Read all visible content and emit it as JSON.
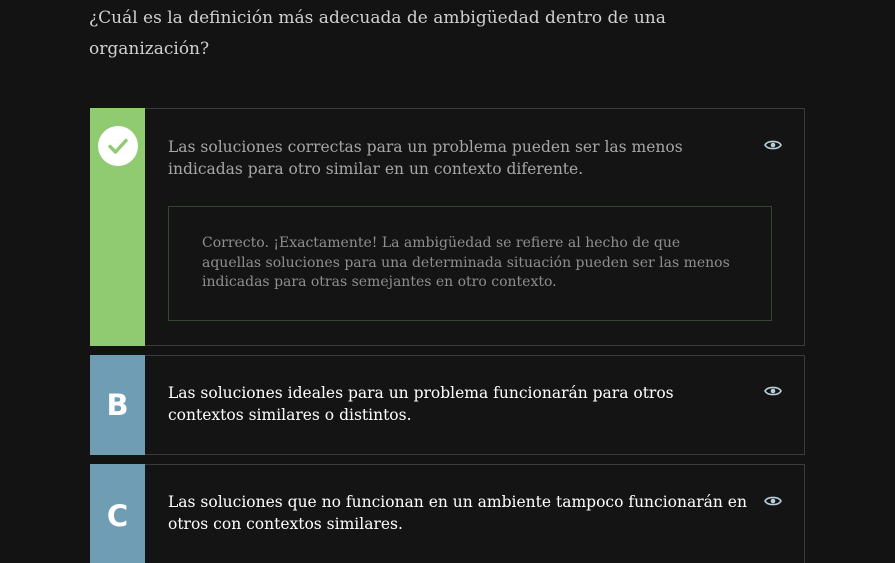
{
  "question": {
    "text": "¿Cuál es la definición más adecuada de ambigüedad dentro de una organización?"
  },
  "options": [
    {
      "status": "correct",
      "marker_icon": "check-icon",
      "text": "Las soluciones correctas para un problema pueden ser las menos indicadas para otro similar en un contexto diferente.",
      "feedback": "Correcto. ¡Exactamente! La ambigüedad se refiere al hecho de que aquellas soluciones para una determinada situación pueden ser las menos indicadas para otras semejantes en otro contexto."
    },
    {
      "letter": "B",
      "text": "Las soluciones ideales para un problema funcionarán para otros contextos similares o distintos."
    },
    {
      "letter": "C",
      "text": "Las soluciones que no funcionan en un ambiente tampoco funcionarán en otros con contextos similares."
    }
  ],
  "icons": {
    "reveal": "eye-icon"
  },
  "colors": {
    "background": "#131313",
    "correct_marker": "#91cb71",
    "option_marker": "#6f9db3",
    "feedback_border": "#334630",
    "card_border": "#3b3b3b"
  }
}
